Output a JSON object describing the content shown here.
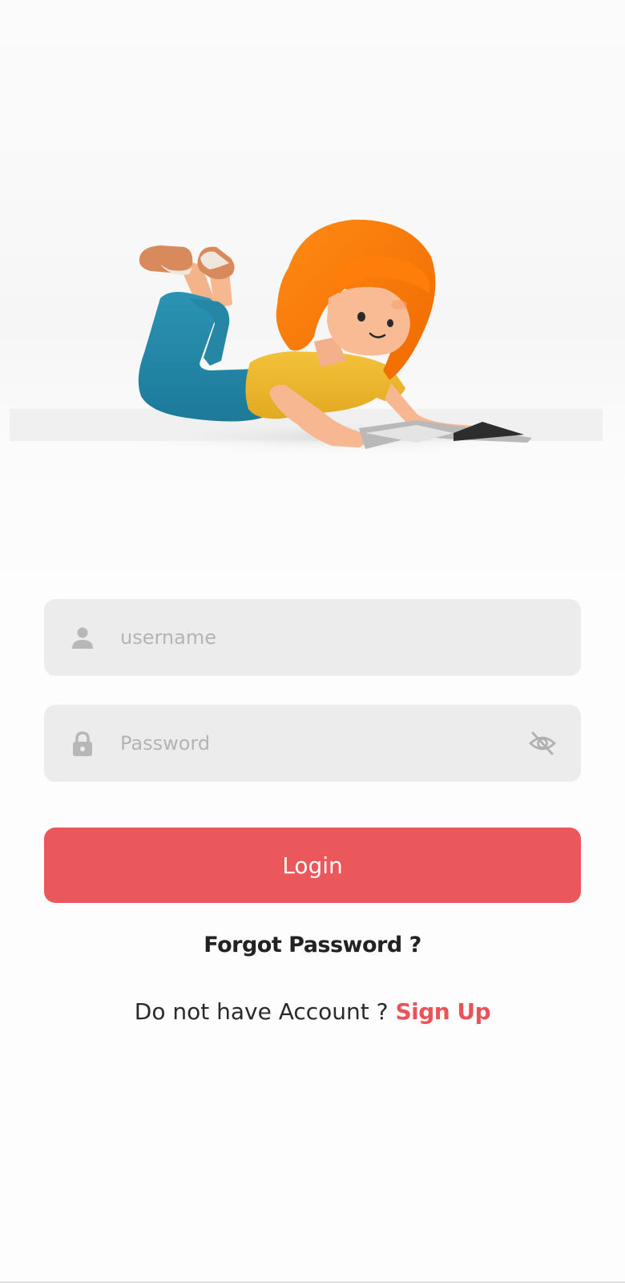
{
  "hero": {
    "illustration": "girl-reading-book-illustration"
  },
  "form": {
    "username": {
      "value": "",
      "placeholder": "username",
      "icon": "person-icon"
    },
    "password": {
      "value": "",
      "placeholder": "Password",
      "icon": "lock-icon",
      "toggle_icon": "eye-off-icon"
    },
    "login_label": "Login"
  },
  "links": {
    "forgot_password": "Forgot Password ?",
    "no_account_text": "Do not have Account ? ",
    "signup_label": "Sign Up"
  },
  "colors": {
    "accent": "#eb585b",
    "field_bg": "#ececec",
    "link": "#e8545a"
  }
}
